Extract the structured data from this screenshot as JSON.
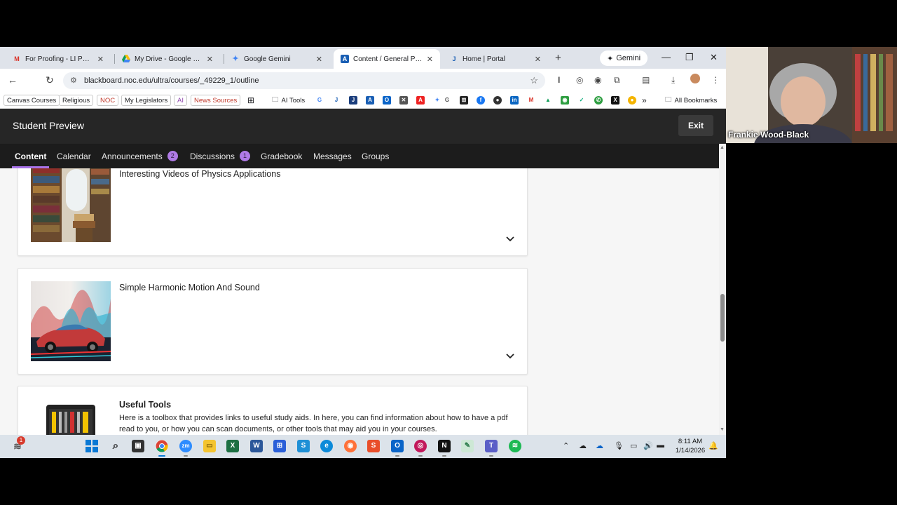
{
  "browser": {
    "tabs": [
      {
        "label": "For Proofing - LI Post - fr",
        "favicon": "gmail-icon",
        "active": false
      },
      {
        "label": "My Drive - Google Drive",
        "favicon": "google-drive-icon",
        "active": false
      },
      {
        "label": "Google Gemini",
        "favicon": "gemini-icon",
        "active": false
      },
      {
        "label": "Content / General Physic",
        "favicon": "blackboard-icon",
        "active": true
      },
      {
        "label": "Home | Portal",
        "favicon": "portal-icon",
        "active": false
      }
    ],
    "gemini_button": "Gemini",
    "url": "blackboard.noc.edu/ultra/courses/_49229_1/outline",
    "bookmarks": [
      "Canvas Courses",
      "Religious",
      "NOC",
      "My Legislators",
      "AI",
      "News Sources",
      "AI Tools"
    ],
    "all_bookmarks": "All Bookmarks",
    "overflow": "»"
  },
  "page": {
    "preview_title": "Student Preview",
    "exit_label": "Exit",
    "nav": [
      {
        "label": "Content",
        "badge": ""
      },
      {
        "label": "Calendar",
        "badge": ""
      },
      {
        "label": "Announcements",
        "badge": "2"
      },
      {
        "label": "Discussions",
        "badge": "1"
      },
      {
        "label": "Gradebook",
        "badge": ""
      },
      {
        "label": "Messages",
        "badge": ""
      },
      {
        "label": "Groups",
        "badge": ""
      }
    ],
    "cards": [
      {
        "title": "Interesting Videos of Physics Applications",
        "description": ""
      },
      {
        "title": "Simple Harmonic Motion And Sound",
        "description": ""
      },
      {
        "title": "Useful Tools",
        "description": "Here is a toolbox that provides links to useful study aids. In here, you can find information about how to have a pdf read to you, or how you can scan documents, or other tools that may aid you in your courses."
      }
    ],
    "help_label": "?"
  },
  "taskbar": {
    "notification_count": "1",
    "time": "8:11 AM",
    "date": "1/14/2026"
  },
  "webcam": {
    "name": "Frankie Wood-Black"
  },
  "colors": {
    "accent": "#a873e8",
    "nav_bg": "#1c1c1c",
    "preview_bg": "#262626"
  }
}
